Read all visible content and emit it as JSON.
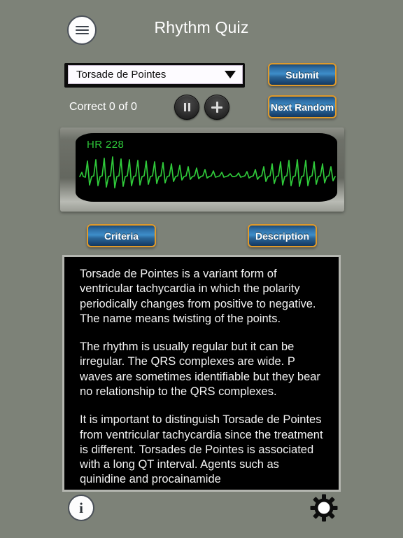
{
  "header": {
    "title": "Rhythm Quiz",
    "menu_icon": "hamburger-menu-icon"
  },
  "controls": {
    "rhythm_select": {
      "value": "Torsade de Pointes",
      "caret_icon": "chevron-down-icon"
    },
    "score_text": "Correct 0 of 0",
    "pause_icon": "pause-icon",
    "add_icon": "plus-icon",
    "submit_label": "Submit",
    "next_random_label": "Next Random"
  },
  "monitor": {
    "hr_label": "HR 228",
    "trace_color": "#2fc93a",
    "screen_color": "#000000"
  },
  "tabs": {
    "criteria_label": "Criteria",
    "description_label": "Description"
  },
  "description": {
    "paragraphs": [
      "Torsade de Pointes is a variant form of ventricular tachycardia in which the polarity periodically changes from positive to negative. The name means twisting of the points.",
      "The rhythm is usually regular but it can be irregular. The QRS complexes are wide. P waves are sometimes identifiable but they bear no relationship to the QRS complexes.",
      "It is important to distinguish Torsade de Pointes from ventricular tachycardia since the treatment is different. Torsades de Pointes is associated with a long QT interval. Agents such as quinidine and procainamide"
    ]
  },
  "footer": {
    "info_icon": "info-icon",
    "info_glyph": "i",
    "settings_icon": "gear-icon"
  },
  "colors": {
    "background": "#7d8278",
    "button_border": "#e09a2a",
    "button_fill": "#3e8ec9",
    "ecg_green": "#2fc93a"
  }
}
